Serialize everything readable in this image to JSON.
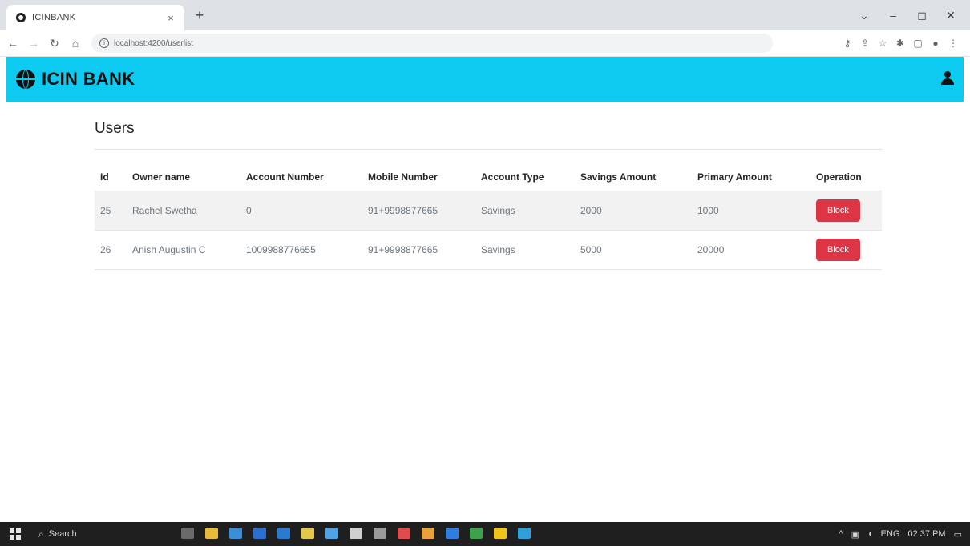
{
  "browser": {
    "tab_title": "ICINBANK",
    "tab_close": "×",
    "new_tab": "+",
    "url": "localhost:4200/userlist",
    "window_controls": {
      "minimize": "–",
      "maximize": "◻",
      "close": "✕",
      "tab_search": "⌄"
    }
  },
  "app": {
    "brand": "ICIN BANK",
    "accent_color": "#0dcaf0",
    "brand_icon": "globe-icon",
    "user_icon": "user-icon"
  },
  "page": {
    "heading": "Users"
  },
  "table": {
    "headers": [
      "Id",
      "Owner name",
      "Account Number",
      "Mobile Number",
      "Account Type",
      "Savings Amount",
      "Primary Amount",
      "Operation"
    ],
    "rows": [
      {
        "id": "25",
        "owner": "Rachel Swetha",
        "account_number": "0",
        "mobile": "91+9998877665",
        "account_type": "Savings",
        "savings": "2000",
        "primary": "1000",
        "operation": "Block"
      },
      {
        "id": "26",
        "owner": "Anish Augustin C",
        "account_number": "1009988776655",
        "mobile": "91+9998877665",
        "account_type": "Savings",
        "savings": "5000",
        "primary": "20000",
        "operation": "Block"
      }
    ],
    "button_color": "#dc3545"
  },
  "taskbar": {
    "search_label": "Search",
    "language": "ENG",
    "time": "02:37 PM"
  }
}
